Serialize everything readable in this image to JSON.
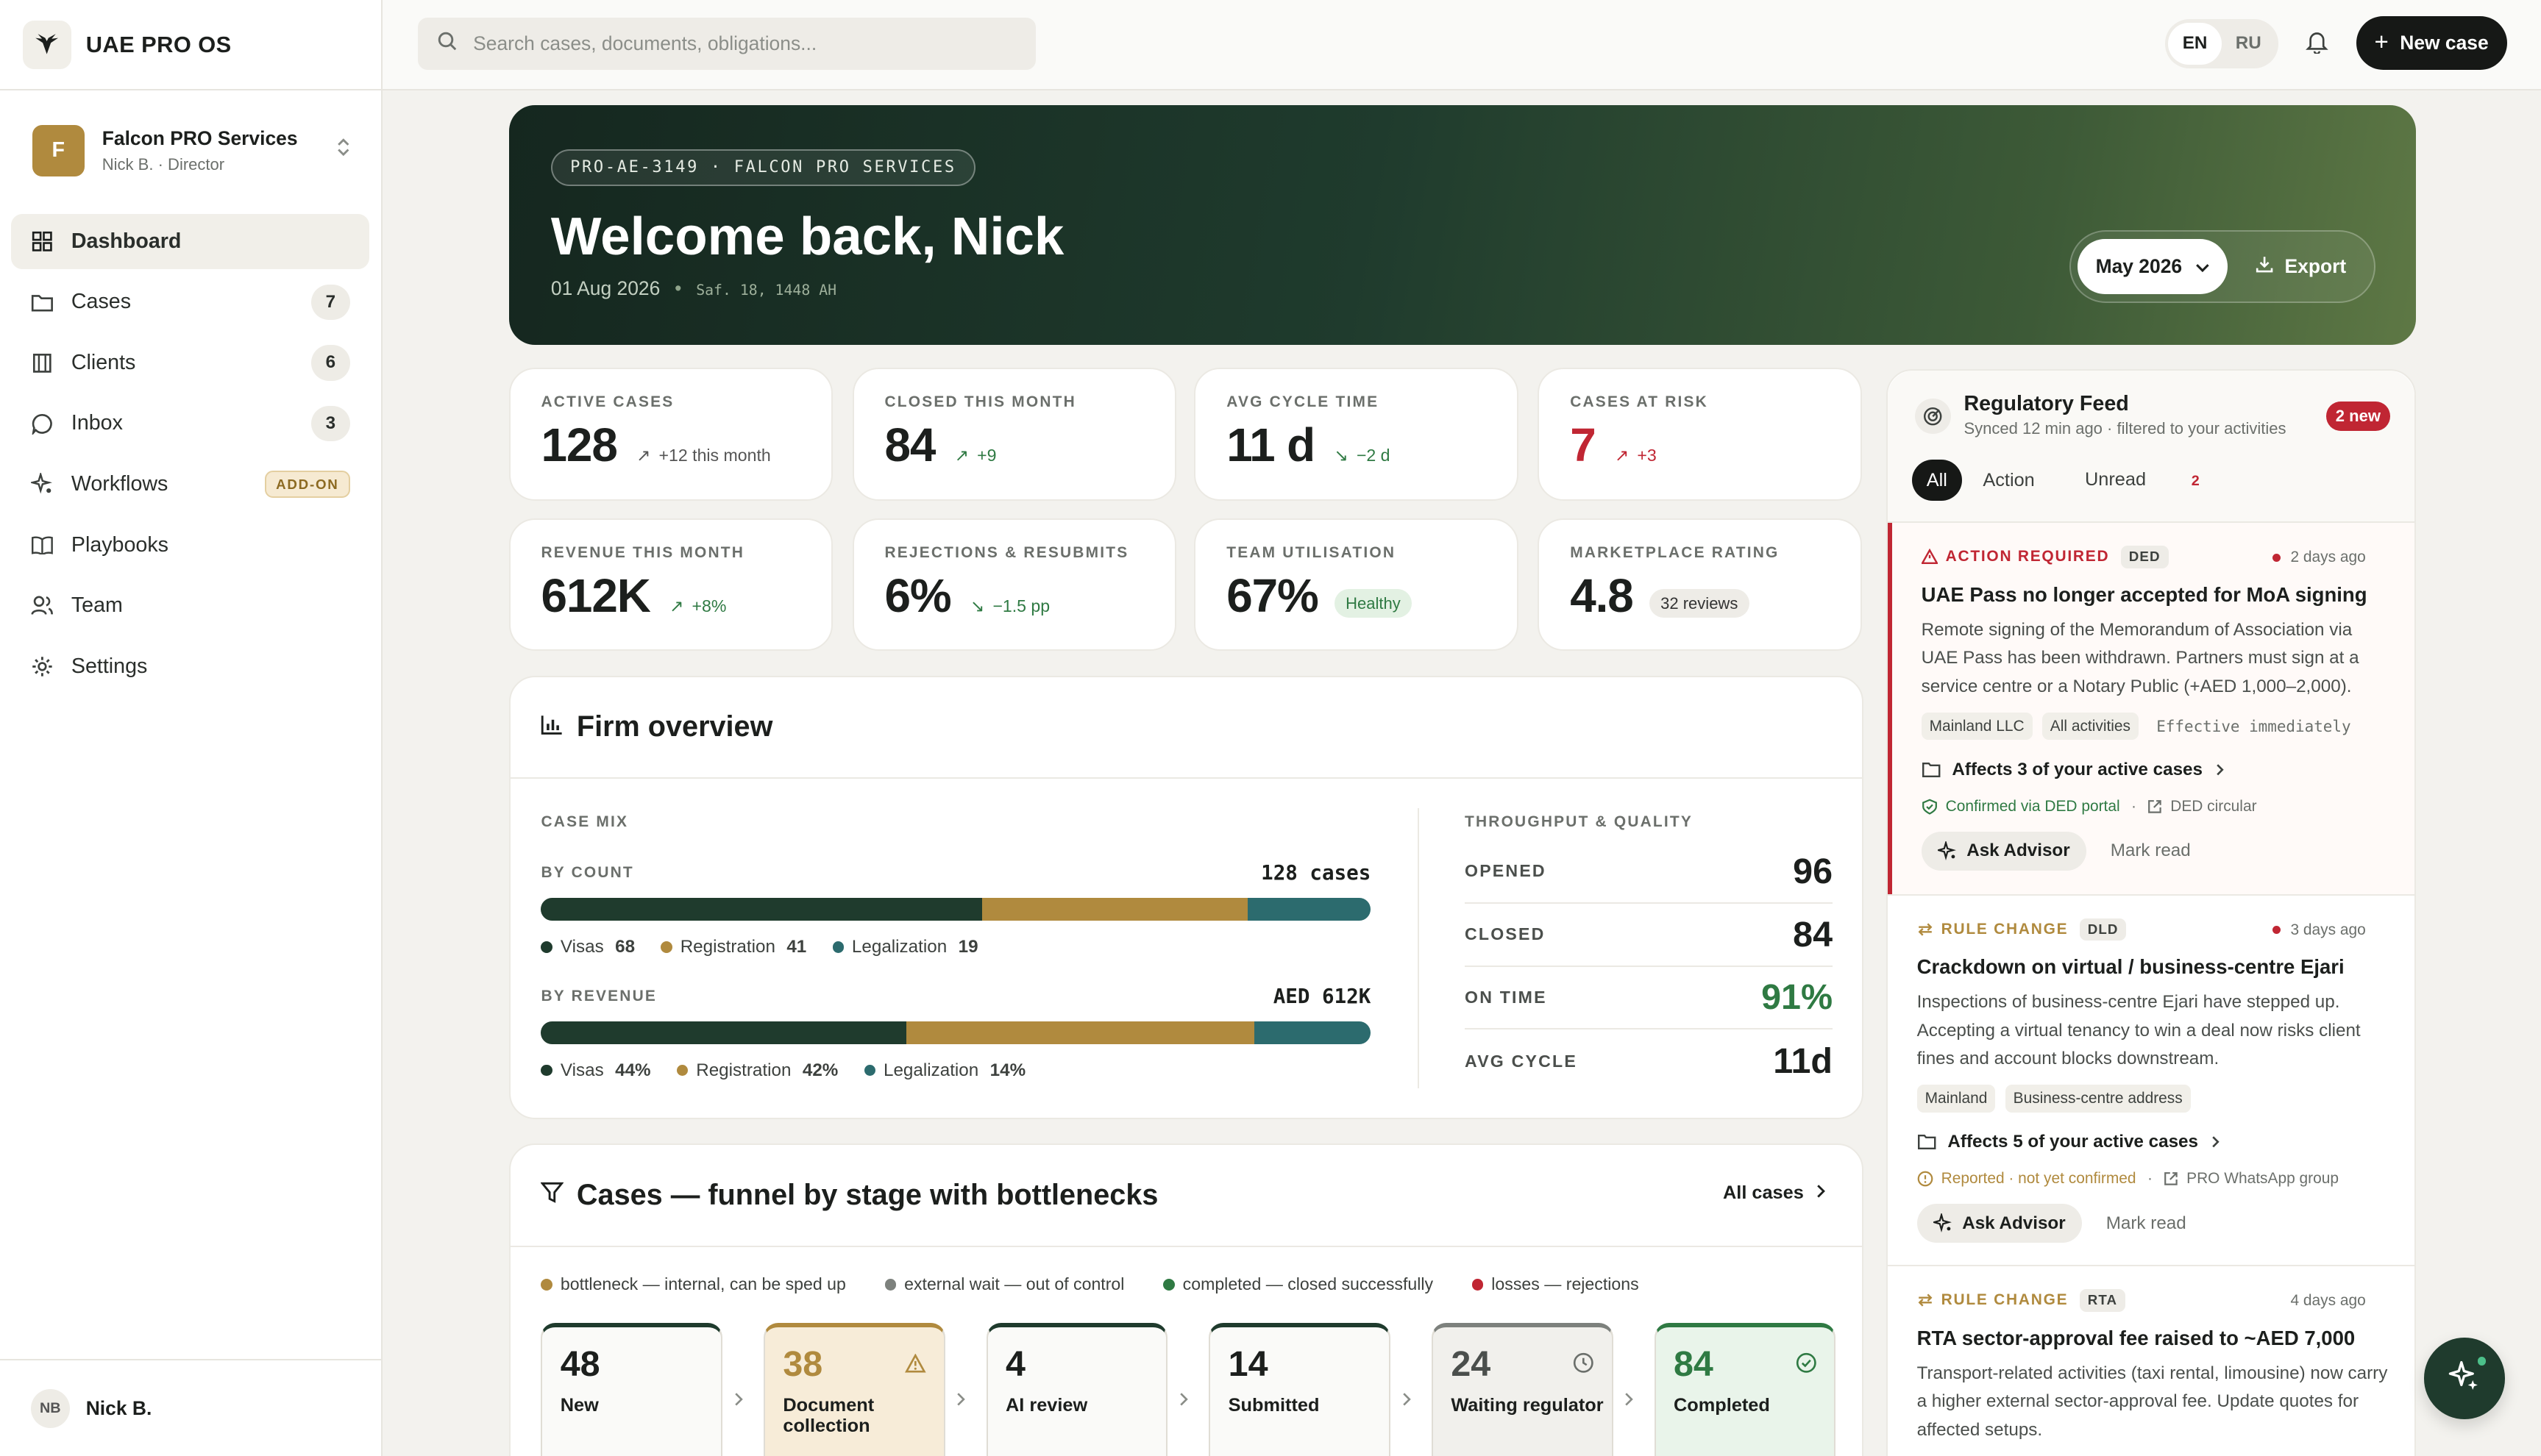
{
  "app": {
    "name": "UAE PRO OS"
  },
  "org": {
    "initial": "F",
    "name": "Falcon PRO Services",
    "user": "Nick B.",
    "role": "Director"
  },
  "nav": [
    {
      "label": "Dashboard",
      "icon": "grid-icon",
      "active": true
    },
    {
      "label": "Cases",
      "icon": "folder-icon",
      "count": "7"
    },
    {
      "label": "Clients",
      "icon": "building-icon",
      "count": "6"
    },
    {
      "label": "Inbox",
      "icon": "chat-icon",
      "count": "3"
    },
    {
      "label": "Workflows",
      "icon": "sparkle-icon",
      "badge": "ADD-ON"
    },
    {
      "label": "Playbooks",
      "icon": "book-icon"
    },
    {
      "label": "Team",
      "icon": "users-icon"
    },
    {
      "label": "Settings",
      "icon": "gear-icon"
    }
  ],
  "userbar": {
    "initials": "NB",
    "name": "Nick B."
  },
  "topbar": {
    "search_placeholder": "Search cases, documents, obligations...",
    "lang_en": "EN",
    "lang_ru": "RU",
    "new_case": "New case"
  },
  "hero": {
    "pill": "PRO-AE-3149 · FALCON PRO SERVICES",
    "title": "Welcome back, Nick",
    "date": "01 Aug 2026",
    "hijri": "Saf. 18, 1448 AH",
    "month": "May 2026",
    "export": "Export"
  },
  "kpis": [
    {
      "label": "ACTIVE CASES",
      "value": "128",
      "delta": "+12 this month",
      "tone": "m",
      "arrow": "↗"
    },
    {
      "label": "CLOSED THIS MONTH",
      "value": "84",
      "delta": "+9",
      "tone": "g",
      "arrow": "↗"
    },
    {
      "label": "AVG CYCLE TIME",
      "value": "11 d",
      "delta": "−2 d",
      "tone": "g",
      "arrow": "↘"
    },
    {
      "label": "CASES AT RISK",
      "value": "7",
      "delta": "+3",
      "tone": "r",
      "arrow": "↗",
      "value_color": "#c02633"
    },
    {
      "label": "REVENUE THIS MONTH",
      "value": "612K",
      "delta": "+8%",
      "tone": "g",
      "arrow": "↗"
    },
    {
      "label": "REJECTIONS & RESUBMITS",
      "value": "6%",
      "delta": "−1.5 pp",
      "tone": "g",
      "arrow": "↘"
    },
    {
      "label": "TEAM UTILISATION",
      "value": "67%",
      "chip": "Healthy",
      "chip_tone": "h"
    },
    {
      "label": "MARKETPLACE RATING",
      "value": "4.8",
      "chip": "32 reviews",
      "chip_tone": "n"
    }
  ],
  "firm": {
    "title": "Firm overview",
    "case_mix": "CASE MIX",
    "by_count": {
      "label": "BY COUNT",
      "total": "128 cases",
      "segments": [
        {
          "name": "Visas",
          "value": 68,
          "display": "68",
          "color": "#1f3b2d"
        },
        {
          "name": "Registration",
          "value": 41,
          "display": "41",
          "color": "#b08a3e"
        },
        {
          "name": "Legalization",
          "value": 19,
          "display": "19",
          "color": "#2c6b6e"
        }
      ]
    },
    "by_revenue": {
      "label": "BY REVENUE",
      "total": "AED 612K",
      "segments": [
        {
          "name": "Visas",
          "value": 44,
          "display": "44%",
          "color": "#1f3b2d"
        },
        {
          "name": "Registration",
          "value": 42,
          "display": "42%",
          "color": "#b08a3e"
        },
        {
          "name": "Legalization",
          "value": 14,
          "display": "14%",
          "color": "#2c6b6e"
        }
      ]
    },
    "tq_title": "THROUGHPUT & QUALITY",
    "tq": [
      {
        "label": "OPENED",
        "value": "96"
      },
      {
        "label": "CLOSED",
        "value": "84"
      },
      {
        "label": "ON TIME",
        "value": "91%",
        "color": "#2f7a43"
      },
      {
        "label": "AVG CYCLE",
        "value": "11d"
      }
    ]
  },
  "funnel": {
    "title": "Cases — funnel by stage with bottlenecks",
    "all_cases": "All cases",
    "legend": [
      {
        "label": "bottleneck — internal, can be sped up",
        "color": "#b08a3e"
      },
      {
        "label": "external wait — out of control",
        "color": "#7d817d"
      },
      {
        "label": "completed — closed successfully",
        "color": "#2f7a43"
      },
      {
        "label": "losses — rejections",
        "color": "#c02633"
      }
    ],
    "stages": [
      {
        "count": "48",
        "label": "New"
      },
      {
        "count": "38",
        "label": "Document collection",
        "kind": "bottleneck"
      },
      {
        "count": "4",
        "label": "AI review"
      },
      {
        "count": "14",
        "label": "Submitted"
      },
      {
        "count": "24",
        "label": "Waiting regulator",
        "kind": "external"
      },
      {
        "count": "84",
        "label": "Completed",
        "kind": "completed"
      }
    ]
  },
  "feed": {
    "title": "Regulatory Feed",
    "subtitle": "Synced 12 min ago · filtered to your activities",
    "new_badge": "2 new",
    "tabs": {
      "all": "All",
      "action": "Action",
      "unread": "Unread",
      "unread_count": "2"
    },
    "items": [
      {
        "type": "ACTION REQUIRED",
        "source": "DED",
        "ago": "2 days ago",
        "title": "UAE Pass no longer accepted for MoA signing",
        "body": "Remote signing of the Memorandum of Association via UAE Pass has been withdrawn. Partners must sign at a service centre or a Notary Public (+AED 1,000–2,000).",
        "tag1": "Mainland LLC",
        "tag2": "All activities",
        "effective": "Effective immediately",
        "affects": "Affects 3 of your active cases",
        "status": "Confirmed via DED portal",
        "ref": "DED circular",
        "ask": "Ask Advisor",
        "mark": "Mark read"
      },
      {
        "type": "RULE CHANGE",
        "source": "DLD",
        "ago": "3 days ago",
        "title": "Crackdown on virtual / business-centre Ejari",
        "body": "Inspections of business-centre Ejari have stepped up. Accepting a virtual tenancy to win a deal now risks client fines and account blocks downstream.",
        "tag1": "Mainland",
        "tag2": "Business-centre address",
        "affects": "Affects 5 of your active cases",
        "status": "Reported · not yet confirmed",
        "ref": "PRO WhatsApp group",
        "ask": "Ask Advisor",
        "mark": "Mark read"
      },
      {
        "type": "RULE CHANGE",
        "source": "RTA",
        "ago": "4 days ago",
        "title": "RTA sector-approval fee raised to ~AED 7,000",
        "body": "Transport-related activities (taxi rental, limousine) now carry a higher external sector-approval fee. Update quotes for affected setups."
      }
    ]
  },
  "colors": {
    "brand_green": "#1f3b2d",
    "gold": "#b08a3e",
    "teal": "#2c6b6e",
    "red": "#c02633",
    "success": "#2f7a43"
  }
}
